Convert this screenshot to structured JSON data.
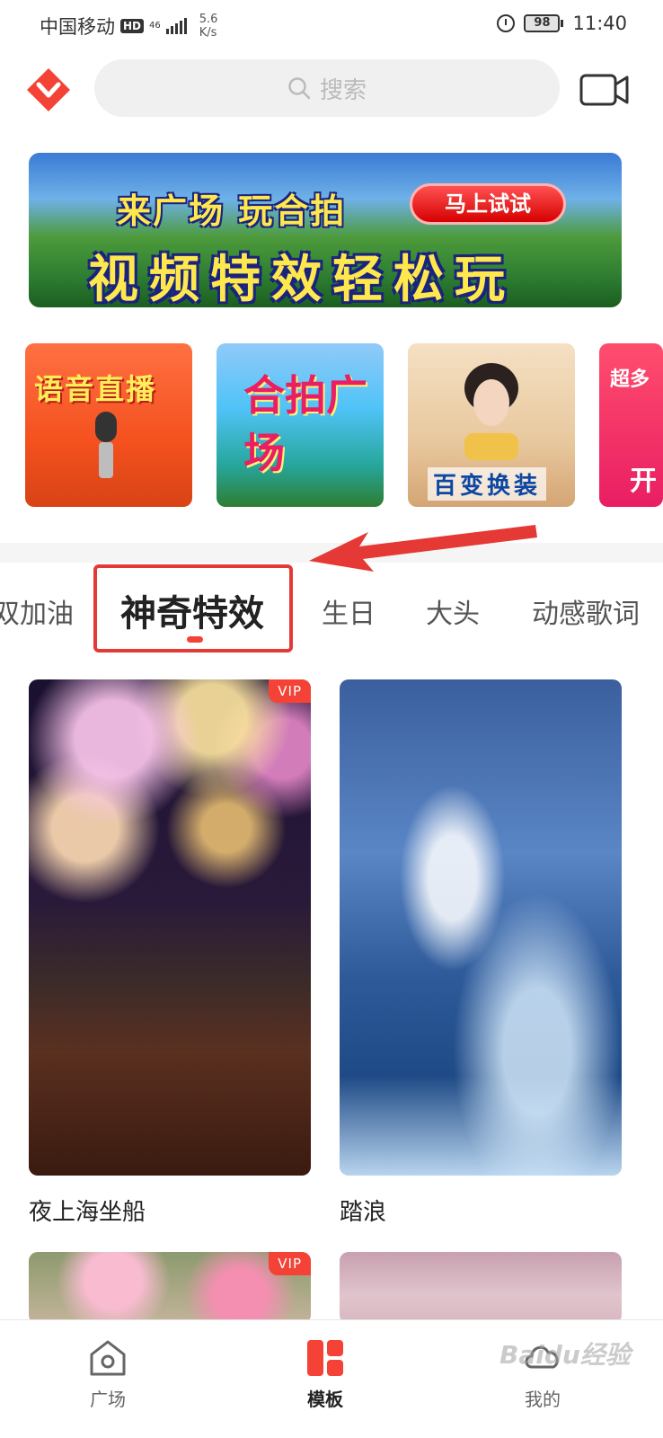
{
  "status_bar": {
    "carrier": "中国移动",
    "hd": "HD",
    "network": "46",
    "speed_value": "5.6",
    "speed_unit": "K/s",
    "battery": "98",
    "time": "11:40"
  },
  "header": {
    "search_placeholder": "搜索"
  },
  "banner": {
    "line1": "来广场 玩合拍",
    "cta": "马上试试",
    "line2": "视频特效轻松玩"
  },
  "feature_tiles": [
    {
      "label": "语音直播"
    },
    {
      "label": "合拍广场"
    },
    {
      "label": "百变换装"
    },
    {
      "label": "超多",
      "sub": "开"
    }
  ],
  "tabs": [
    {
      "label": "双加油"
    },
    {
      "label": "神奇特效",
      "active": true
    },
    {
      "label": "生日"
    },
    {
      "label": "大头"
    },
    {
      "label": "动感歌词"
    }
  ],
  "cards": [
    {
      "title": "夜上海坐船",
      "vip": "VIP"
    },
    {
      "title": "踏浪"
    },
    {
      "title": "",
      "vip": "VIP"
    },
    {
      "title": ""
    }
  ],
  "bottom_nav": [
    {
      "label": "广场",
      "icon": "plaza-icon"
    },
    {
      "label": "模板",
      "icon": "template-icon",
      "active": true
    },
    {
      "label": "我的",
      "icon": "profile-icon"
    }
  ],
  "watermark": "Baidu经验",
  "colors": {
    "accent": "#f44336",
    "brand": "#f44336"
  }
}
